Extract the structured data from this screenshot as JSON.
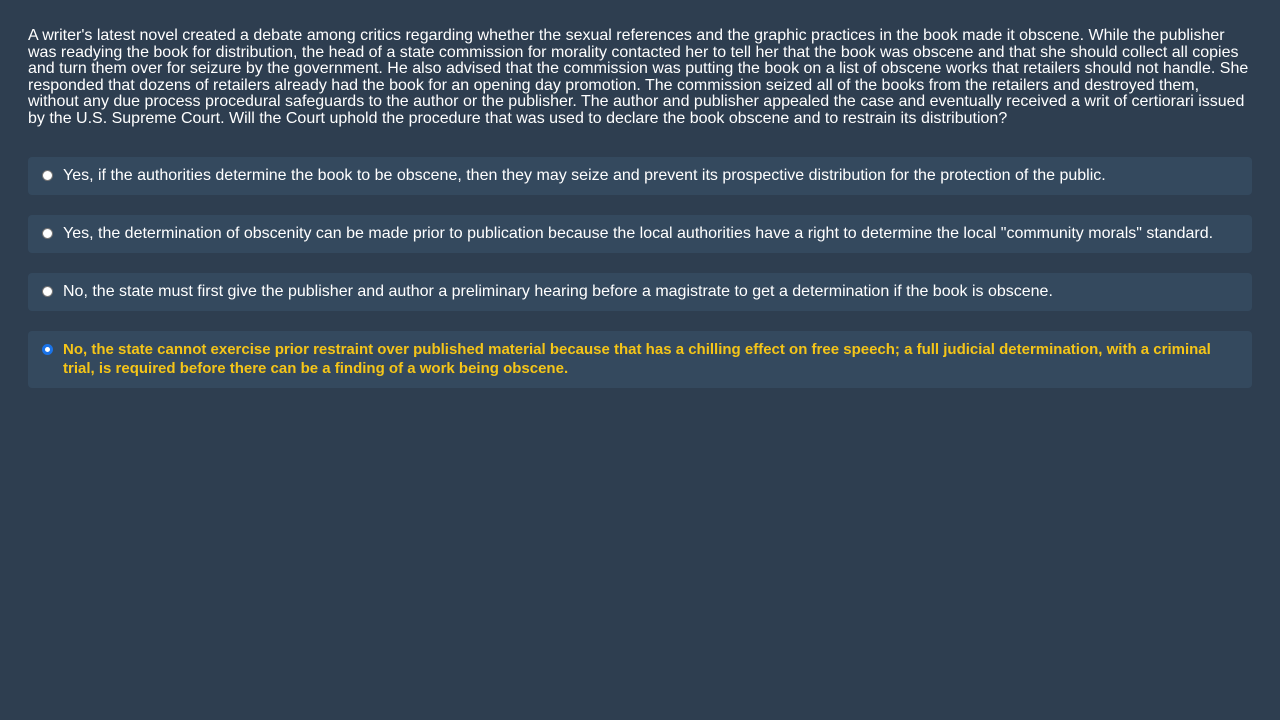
{
  "question": {
    "text": "A writer's latest novel created a debate among critics regarding whether the sexual references and the graphic practices in the book made it obscene. While the publisher was readying the book for distribution, the head of a state commission for morality contacted her to tell her that the book was obscene and that she should collect all copies and turn them over for seizure by the government. He also advised that the commission was putting the book on a list of obscene works that retailers should not handle. She responded that dozens of retailers already had the book for an opening day promotion. The commission seized all of the books from the retailers and destroyed them, without any due process procedural safeguards to the author or the publisher. The author and publisher appealed the case and eventually received a writ of certiorari issued by the U.S. Supreme Court. Will the Court uphold the procedure that was used to declare the book obscene and to restrain its distribution?"
  },
  "options": [
    {
      "label": "Yes, if the authorities determine the book to be obscene, then they may seize and prevent its prospective distribution for the protection of the public.",
      "selected": false
    },
    {
      "label": "Yes, the determination of obscenity can be made prior to publication because the local authorities have a right to determine the local \"community morals\" standard.",
      "selected": false
    },
    {
      "label": "No, the state must first give the publisher and author a preliminary hearing before a magistrate to get a determination if the book is obscene.",
      "selected": false
    },
    {
      "label": "No, the state cannot exercise prior restraint over published material because that has a chilling effect on free speech; a full judicial determination, with a criminal trial, is required before there can be a finding of a work being obscene.",
      "selected": true
    }
  ],
  "colors": {
    "background": "#2e3e50",
    "option_background": "#34495e",
    "selected_text": "#f5c518",
    "text": "#ffffff"
  }
}
